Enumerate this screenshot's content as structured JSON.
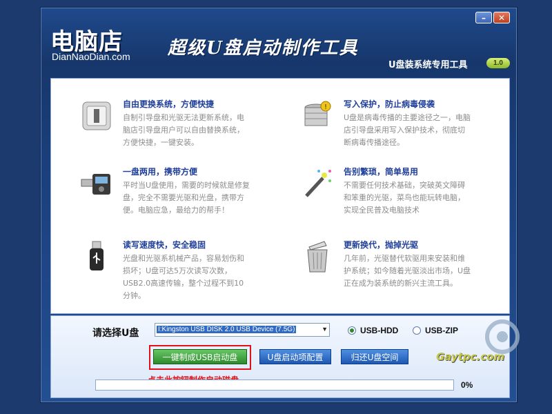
{
  "window": {
    "min_label": "–",
    "close_label": "✕"
  },
  "header": {
    "logo_cn": "电脑店",
    "logo_en": "DianNaoDian.com",
    "slogan": "超级U盘启动制作工具",
    "subtitle": "U盘装系统专用工具",
    "version": "1.0"
  },
  "features": [
    {
      "icon": "power-switch-icon",
      "title": "自由更换系统，方便快捷",
      "desc": "自制引导盘和光驱无法更新系统，电脑店引导盘用户可以自由替换系统，方便快捷，一键安装。"
    },
    {
      "icon": "database-lock-icon",
      "title": "写入保护，防止病毒侵袭",
      "desc": "U盘是病毒传播的主要途径之一，电脑店引导盘采用写入保护技术，彻底切断病毒传播途径。"
    },
    {
      "icon": "usb-mp3-icon",
      "title": "一盘两用，携带方便",
      "desc": "平时当U盘使用，需要的时候就是修复盘，完全不需要光驱和光盘，携带方便。电脑应急，最给力的帮手！"
    },
    {
      "icon": "magic-wand-icon",
      "title": "告别繁琐，简单易用",
      "desc": "不需要任何技术基础，突破英文障碍和笨重的光驱，菜鸟也能玩转电脑，实现全民普及电脑技术"
    },
    {
      "icon": "usb-drive-icon",
      "title": "读写速度快，安全稳固",
      "desc": "光盘和光驱系机械产品，容易划伤和损坏；U盘可达5万次读写次数，USB2.0高速传输，整个过程不到10分钟。"
    },
    {
      "icon": "trash-can-icon",
      "title": "更新换代，抛掉光驱",
      "desc": "几年前，光驱替代软驱用来安装和维护系统；如今随着光驱淡出市场，U盘正在成为装系统的新兴主流工具。"
    }
  ],
  "bottom": {
    "select_label": "请选择U盘",
    "select_value": "I:Kingston USB DISK 2.0 USB Device (7.5G)",
    "radio_hdd": "USB-HDD",
    "radio_zip": "USB-ZIP",
    "selected_mode": "USB-HDD",
    "btn_make": "一键制成USB启动盘",
    "btn_config": "U盘启动项配置",
    "btn_restore": "归还U盘空间",
    "hint": "点击此按钮制作启动磁盘",
    "progress_text": "0%",
    "progress_value": 0
  },
  "watermark": {
    "text": "Gaytpc.com"
  },
  "colors": {
    "accent": "#1f3f9a",
    "highlight": "#e0111a",
    "green": "#2d8a2c",
    "blue": "#1e58b3"
  }
}
